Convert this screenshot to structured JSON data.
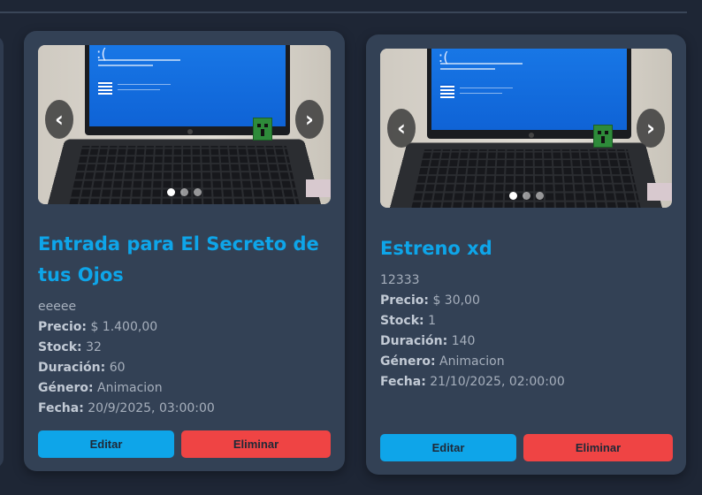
{
  "products": [
    {
      "title": "Entrada para El Secreto de tus Ojos",
      "description": "eeeee",
      "price_label": "Precio:",
      "price": "$ 1.400,00",
      "stock_label": "Stock:",
      "stock": "32",
      "duration_label": "Duración:",
      "duration": "60",
      "genre_label": "Género:",
      "genre": "Animacion",
      "date_label": "Fecha:",
      "date": "20/9/2025, 03:00:00",
      "edit_label": "Editar",
      "delete_label": "Eliminar",
      "prev_icon": "‹",
      "next_icon": "›",
      "slides": 3,
      "active_slide": 0
    },
    {
      "title": "Estreno xd",
      "description": "12333",
      "price_label": "Precio:",
      "price": "$ 30,00",
      "stock_label": "Stock:",
      "stock": "1",
      "duration_label": "Duración:",
      "duration": "140",
      "genre_label": "Género:",
      "genre": "Animacion",
      "date_label": "Fecha:",
      "date": "21/10/2025, 02:00:00",
      "edit_label": "Editar",
      "delete_label": "Eliminar",
      "prev_icon": "‹",
      "next_icon": "›",
      "slides": 3,
      "active_slide": 0
    }
  ],
  "colors": {
    "background": "#1e2635",
    "card": "#334155",
    "title": "#0ea5e9",
    "edit_button": "#0ea5e9",
    "delete_button": "#ef4444"
  }
}
